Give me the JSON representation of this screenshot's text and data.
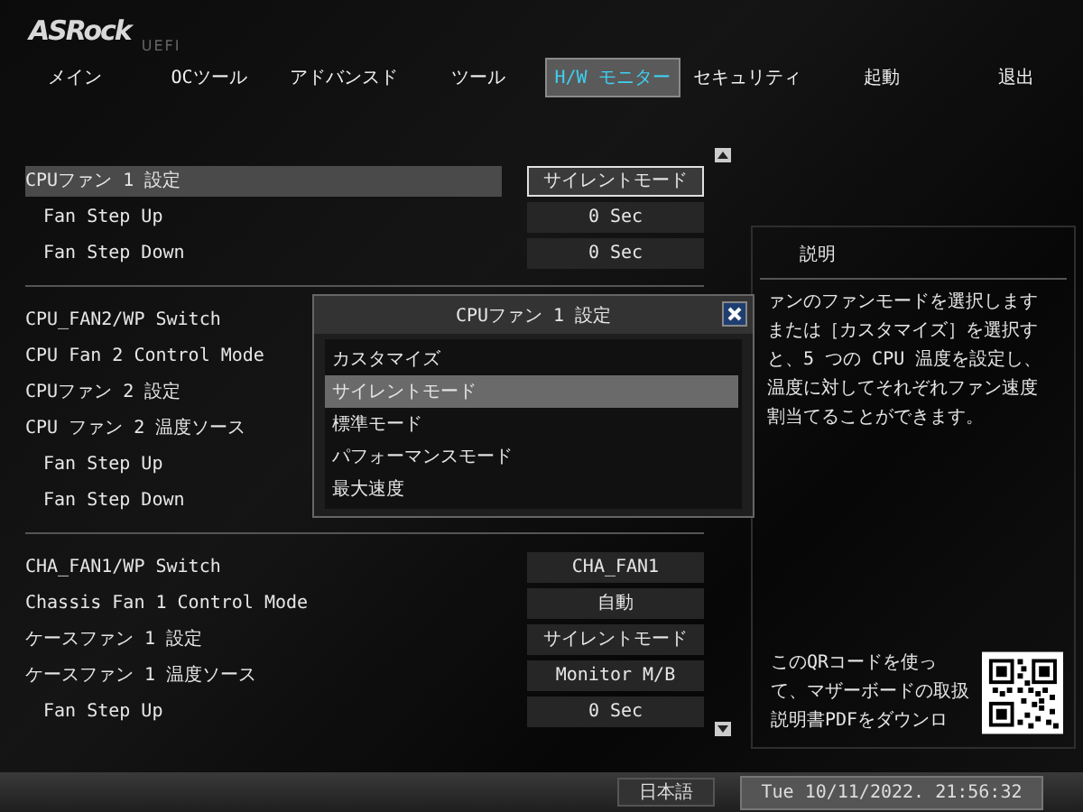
{
  "header": {
    "logo": "ASRock",
    "subtitle": "UEFI"
  },
  "tabs": [
    {
      "label": "メイン",
      "selected": false
    },
    {
      "label": "OCツール",
      "selected": false
    },
    {
      "label": "アドバンスド",
      "selected": false
    },
    {
      "label": "ツール",
      "selected": false
    },
    {
      "label": "H/W モニター",
      "selected": true
    },
    {
      "label": "セキュリティ",
      "selected": false
    },
    {
      "label": "起動",
      "selected": false
    },
    {
      "label": "退出",
      "selected": false
    }
  ],
  "groups": [
    {
      "rows": [
        {
          "kind": "item",
          "label": "CPUファン 1 設定",
          "value": "サイレントモード",
          "selected": true
        },
        {
          "kind": "subitem",
          "label": "Fan Step Up",
          "value": "0 Sec",
          "selected": false
        },
        {
          "kind": "subitem",
          "label": "Fan Step Down",
          "value": "0 Sec",
          "selected": false
        }
      ]
    },
    {
      "rows": [
        {
          "kind": "item",
          "label": "CPU_FAN2/WP Switch",
          "selected": false
        },
        {
          "kind": "item",
          "label": "CPU Fan 2 Control Mode",
          "selected": false
        },
        {
          "kind": "item",
          "label": "CPUファン 2 設定",
          "selected": false
        },
        {
          "kind": "item",
          "label": "CPU ファン 2 温度ソース",
          "selected": false
        },
        {
          "kind": "subitem",
          "label": "Fan Step Up",
          "selected": false
        },
        {
          "kind": "subitem",
          "label": "Fan Step Down",
          "selected": false
        }
      ]
    },
    {
      "rows": [
        {
          "kind": "item",
          "label": "CHA_FAN1/WP Switch",
          "value": "CHA_FAN1",
          "selected": false
        },
        {
          "kind": "item",
          "label": "Chassis Fan 1 Control Mode",
          "value": "自動",
          "selected": false
        },
        {
          "kind": "item",
          "label": "ケースファン 1 設定",
          "value": "サイレントモード",
          "selected": false
        },
        {
          "kind": "item",
          "label": "ケースファン 1 温度ソース",
          "value": "Monitor M/B",
          "selected": false
        },
        {
          "kind": "subitem",
          "label": "Fan Step Up",
          "value": "0 Sec",
          "selected": false
        }
      ]
    }
  ],
  "description": {
    "title": "説明",
    "lines": [
      "ァンのファンモードを選択します",
      "または［カスタマイズ］を選択す",
      "と、5 つの CPU 温度を設定し、",
      "温度に対してそれぞれファン速度",
      "割当てることができます。"
    ],
    "qr_text": "このQRコードを使って、マザーボードの取扱説明書PDFをダウンロ"
  },
  "dialog": {
    "title": "CPUファン 1 設定",
    "options": [
      {
        "label": "カスタマイズ",
        "selected": false
      },
      {
        "label": "サイレントモード",
        "selected": true
      },
      {
        "label": "標準モード",
        "selected": false
      },
      {
        "label": "パフォーマンスモード",
        "selected": false
      },
      {
        "label": "最大速度",
        "selected": false
      }
    ]
  },
  "status_bar": {
    "language": "日本語",
    "datetime": "Tue 10/11/2022. 21:56:32"
  }
}
